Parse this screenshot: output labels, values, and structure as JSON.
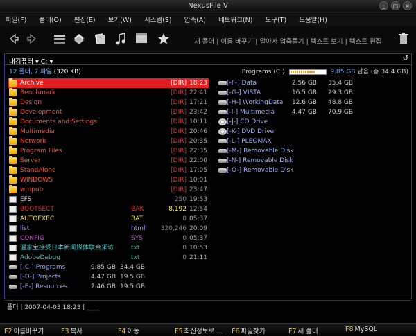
{
  "window": {
    "title": "NexusFile V"
  },
  "menu": [
    "파일(F)",
    "폴더(O)",
    "편집(E)",
    "보기(W)",
    "시스템(S)",
    "압축(A)",
    "네트워크(N)",
    "도구(T)",
    "도움말(H)"
  ],
  "toolbar": {
    "links": "새 폴더 | 이름 바꾸기 | 알아서 압축풀기 | 텍스트 보기 | 텍스트 편집"
  },
  "panel": {
    "path": "내컴퓨터 ▾ C: ▾",
    "refresh_glyph": "↺",
    "summary_left_count": "12 폴더, 7 파일",
    "summary_left_size": "(320 KB)",
    "drive_label": "Programs (C:)",
    "drive_used_fraction": 0.72,
    "drive_free": "9.85 GB",
    "drive_free_label": "남음 (총 34.4 GB)"
  },
  "files": [
    {
      "name": "Archive",
      "type": "folder",
      "ext": "",
      "size": "[DIR]",
      "time": "18:23",
      "selected": true
    },
    {
      "name": "Benchmark",
      "type": "folder",
      "ext": "",
      "size": "[DIR]",
      "time": "22:41"
    },
    {
      "name": "Design",
      "type": "folder",
      "ext": "",
      "size": "[DIR]",
      "time": "17:21"
    },
    {
      "name": "Development",
      "type": "folder",
      "ext": "",
      "size": "[DIR]",
      "time": "23:42"
    },
    {
      "name": "Documents and Settings",
      "type": "folder",
      "ext": "",
      "size": "[DIR]",
      "time": "10:11"
    },
    {
      "name": "Multimedia",
      "type": "folder",
      "ext": "",
      "size": "[DIR]",
      "time": "20:46"
    },
    {
      "name": "Network",
      "type": "folder",
      "ext": "",
      "size": "[DIR]",
      "time": "20:35"
    },
    {
      "name": "Program Files",
      "type": "folder",
      "ext": "",
      "size": "[DIR]",
      "time": "22:35"
    },
    {
      "name": "Server",
      "type": "folder",
      "ext": "",
      "size": "[DIR]",
      "time": "22:00"
    },
    {
      "name": "StandAlone",
      "type": "folder",
      "ext": "",
      "size": "[DIR]",
      "time": "17:05"
    },
    {
      "name": "WINDOWS",
      "type": "folder",
      "ext": "",
      "size": "[DIR]",
      "time": "10:01"
    },
    {
      "name": "wmpub",
      "type": "folder",
      "ext": "",
      "size": "[DIR]",
      "time": "23:47"
    },
    {
      "name": "EFS",
      "type": "doc",
      "ext": "",
      "size": "250",
      "time": "19:53"
    },
    {
      "name": "BOOTSECT",
      "type": "doc",
      "ext": "BAK",
      "size": "8,192",
      "time": "12:54"
    },
    {
      "name": "AUTOEXEC",
      "type": "doc",
      "ext": "BAT",
      "size": "0",
      "time": "05:37"
    },
    {
      "name": "list",
      "type": "doc",
      "ext": "html",
      "size": "320,246",
      "time": "20:09"
    },
    {
      "name": "CONFIG",
      "type": "doc",
      "ext": "SYS",
      "size": "0",
      "time": "05:37"
    },
    {
      "name": "温家宝接受日本新闻媒体联合采访",
      "type": "doc",
      "ext": "txt",
      "size": "0",
      "time": "10:53"
    },
    {
      "name": "AdobeDebug",
      "type": "doc",
      "ext": "txt",
      "size": "0",
      "time": "21:11"
    }
  ],
  "left_drives": [
    {
      "name": "[-C-] Programs",
      "free": "9.85 GB",
      "total": "34.4 GB"
    },
    {
      "name": "[-D-] Projects",
      "free": "4.47 GB",
      "total": "19.5 GB"
    },
    {
      "name": "[-E-] Resources",
      "free": "2.46 GB",
      "total": "19.5 GB"
    }
  ],
  "drives": [
    {
      "name": "[-F-] Data",
      "free": "2.56 GB",
      "total": "35.4 GB",
      "kind": "hdd"
    },
    {
      "name": "[-G-] VISTA",
      "free": "16.5 GB",
      "total": "29.3 GB",
      "kind": "hdd"
    },
    {
      "name": "[-H-] WorkingData",
      "free": "12.6 GB",
      "total": "48.8 GB",
      "kind": "hdd"
    },
    {
      "name": "[-I-] Multimedia",
      "free": "4.47 GB",
      "total": "70.9 GB",
      "kind": "hdd"
    },
    {
      "name": "[-J-] CD Drive",
      "free": "",
      "total": "",
      "kind": "disc"
    },
    {
      "name": "[-K-] DVD Drive",
      "free": "",
      "total": "",
      "kind": "disc"
    },
    {
      "name": "[-L-] PLEOMAX",
      "free": "",
      "total": "",
      "kind": "hdd"
    },
    {
      "name": "[-M-] Removable Disk",
      "free": "",
      "total": "",
      "kind": "hdd"
    },
    {
      "name": "[-N-] Removable Disk",
      "free": "",
      "total": "",
      "kind": "hdd"
    },
    {
      "name": "[-O-] Removable Disk",
      "free": "",
      "total": "",
      "kind": "hdd"
    }
  ],
  "status": "폴더 | 2007-04-03 18:23 | ____",
  "fkeys": [
    {
      "key": "F2",
      "label": "이름바꾸기"
    },
    {
      "key": "F3",
      "label": "복사"
    },
    {
      "key": "F4",
      "label": "이동"
    },
    {
      "key": "F5",
      "label": "최신정보로 ..."
    },
    {
      "key": "F6",
      "label": "파일찾기"
    },
    {
      "key": "F7",
      "label": "새 폴더"
    },
    {
      "key": "F8",
      "label": "MySQL"
    }
  ],
  "colors": {
    "folder_text": "#ff4d3d",
    "dir_text": "#e03030",
    "selection": "#e02020",
    "blue_text": "#8fa8ff",
    "bak_text": "#e03030",
    "bat_text": "#ffe84a",
    "sys_text": "#d24bd2",
    "txt_text": "#44bbbb",
    "fkey_color": "#e6c84a"
  }
}
